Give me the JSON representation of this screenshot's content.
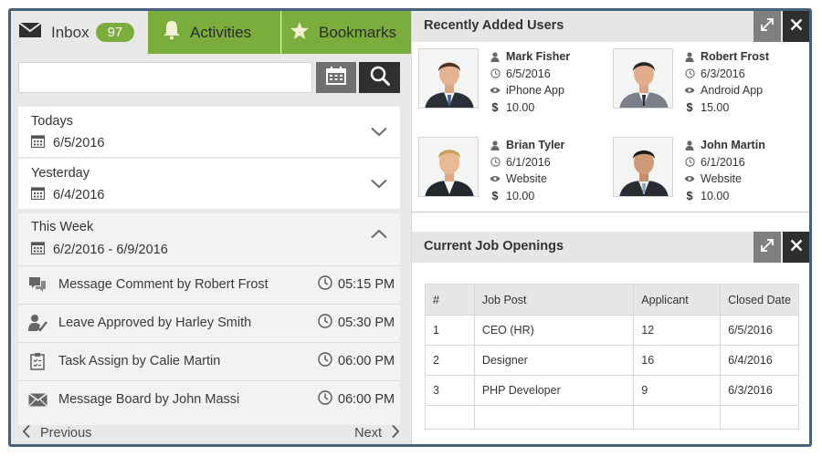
{
  "tabs": {
    "inbox": {
      "label": "Inbox",
      "count": "97"
    },
    "activities": {
      "label": "Activities"
    },
    "bookmarks": {
      "label": "Bookmarks"
    }
  },
  "search": {
    "value": "",
    "placeholder": ""
  },
  "accordion": [
    {
      "title": "Todays",
      "date": "6/5/2016"
    },
    {
      "title": "Yesterday",
      "date": "6/4/2016"
    },
    {
      "title": "This Week",
      "date": "6/2/2016 - 6/9/2016"
    }
  ],
  "activities": [
    {
      "icon": "comment-icon",
      "text": "Message Comment by Robert Frost",
      "time": "05:15 PM"
    },
    {
      "icon": "user-approved-icon",
      "text": "Leave Approved by Harley Smith",
      "time": "05:30 PM"
    },
    {
      "icon": "clipboard-icon",
      "text": "Task Assign by Calie Martin",
      "time": "06:00 PM"
    },
    {
      "icon": "envelope-icon",
      "text": "Message Board by John Massi",
      "time": "06:00 PM"
    }
  ],
  "pager": {
    "prev": "Previous",
    "next": "Next"
  },
  "recent_users": {
    "title": "Recently Added Users",
    "users": [
      {
        "name": "Mark Fisher",
        "date": "6/5/2016",
        "source": "iPhone App",
        "amount": "10.00"
      },
      {
        "name": "Robert Frost",
        "date": "6/3/2016",
        "source": "Android App",
        "amount": "15.00"
      },
      {
        "name": "Brian Tyler",
        "date": "6/1/2016",
        "source": "Website",
        "amount": "10.00"
      },
      {
        "name": "John Martin",
        "date": "6/1/2016",
        "source": "Website",
        "amount": "10.00"
      }
    ]
  },
  "jobs": {
    "title": "Current Job Openings",
    "headers": [
      "#",
      "Job Post",
      "Applicant",
      "Closed Date"
    ],
    "rows": [
      [
        "1",
        "CEO (HR)",
        "12",
        "6/5/2016"
      ],
      [
        "2",
        "Designer",
        "16",
        "6/4/2016"
      ],
      [
        "3",
        "PHP Developer",
        "9",
        "6/3/2016"
      ]
    ]
  },
  "colors": {
    "accent_green": "#7aad3c",
    "frame": "#47617a",
    "dark": "#2e2e2e",
    "grey_button": "#7f7f7f"
  }
}
